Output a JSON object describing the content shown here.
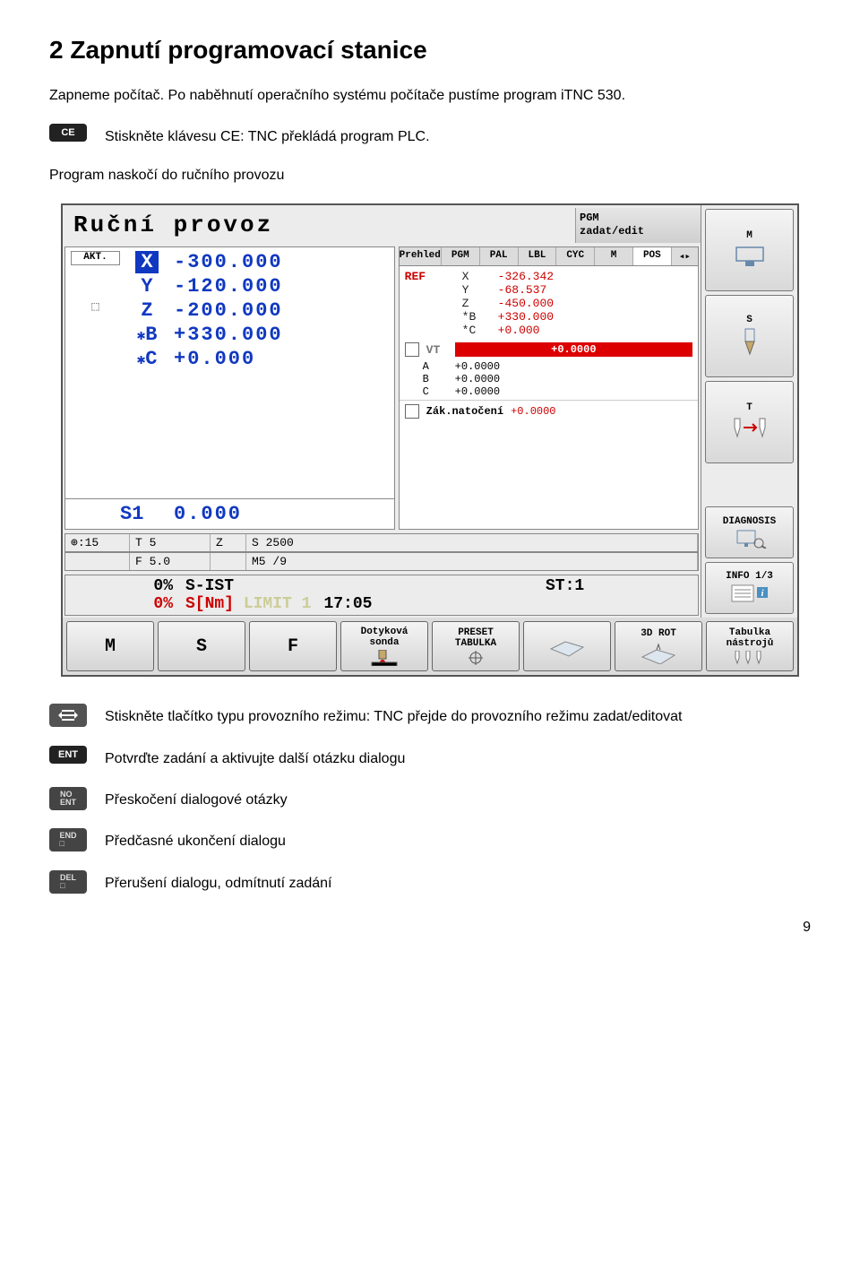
{
  "doc": {
    "heading": "2  Zapnutí programovací stanice",
    "intro": "Zapneme počítač. Po naběhnutí operačního systému počítače pustíme program iTNC 530.",
    "ceKey": "CE",
    "ceText": "Stiskněte klávesu CE: TNC překládá program PLC.",
    "paragraph2": "Program naskočí do ručního provozu",
    "modeText": "Stiskněte tlačítko typu provozního režimu: TNC přejde do provozního režimu zadat/editovat",
    "entKey": "ENT",
    "entText": "Potvrďte zadání a aktivujte další otázku dialogu",
    "noentKey": "NO\nENT",
    "noentText": "Přeskočení dialogové otázky",
    "endKey": "END\n□",
    "endText": "Předčasné ukončení dialogu",
    "delKey": "DEL\n□",
    "delText": "Přerušení dialogu, odmítnutí zadání",
    "pageNum": "9"
  },
  "tnc": {
    "modeTitle": "Ruční provoz",
    "altMode": "PGM\nzadat/edit",
    "sideKeys": {
      "m": "M",
      "s": "S",
      "t": "T",
      "diag": "DIAGNOSIS",
      "info": "INFO 1/3"
    },
    "aktLabel": "AKT.",
    "axes": [
      {
        "badge": true,
        "axis": "X",
        "val": "-300.000"
      },
      {
        "axis": "Y",
        "val": "-120.000"
      },
      {
        "axis": "Z",
        "val": "-200.000"
      },
      {
        "rot": true,
        "axis": "B",
        "val": "+330.000"
      },
      {
        "rot": true,
        "axis": "C",
        "val": "+0.000"
      }
    ],
    "s1": {
      "label": "S1",
      "val": "0.000"
    },
    "tabs": [
      "Prehled",
      "PGM",
      "PAL",
      "LBL",
      "CYC",
      "M",
      "POS",
      "◂▸"
    ],
    "activeTab": 6,
    "ref": {
      "label": "REF",
      "rows": [
        {
          "a": "X",
          "v": "-326.342"
        },
        {
          "a": "Y",
          "v": "-68.537"
        },
        {
          "a": "Z",
          "v": "-450.000"
        },
        {
          "a": "*B",
          "v": "+330.000"
        },
        {
          "a": "*C",
          "v": "+0.000"
        }
      ]
    },
    "vt": {
      "label": "VT",
      "value": "+0.0000"
    },
    "abc": [
      {
        "a": "A",
        "v": "+0.0000"
      },
      {
        "a": "B",
        "v": "+0.0000"
      },
      {
        "a": "C",
        "v": "+0.0000"
      }
    ],
    "zak": {
      "label": "Zák.natočení",
      "value": "+0.0000"
    },
    "status1": {
      "preset": "⊕:15",
      "t": "T 5",
      "z": "Z",
      "s2500": "S 2500",
      "f": "F 5.0",
      "m": "M5 /9"
    },
    "bottom": {
      "p1": "0%",
      "s_ist": "S-IST",
      "st": "ST:1",
      "p2": "0%",
      "snm": "S[Nm]",
      "limit": "LIMIT 1",
      "time": "17:05"
    },
    "softkeys": [
      "M",
      "S",
      "F",
      "Dotyková\nsonda",
      "PRESET\nTABULKA",
      "",
      "3D ROT",
      "Tabulka\nnástrojů"
    ]
  }
}
